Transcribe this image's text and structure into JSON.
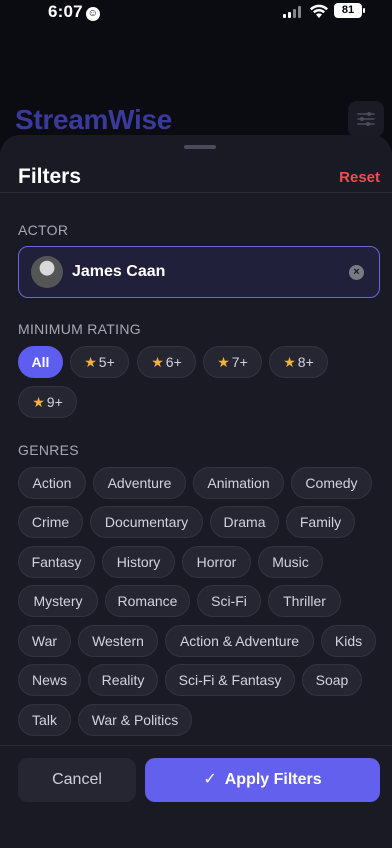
{
  "status": {
    "time": "6:07",
    "battery": "81"
  },
  "background": {
    "app_title": "StreamWise"
  },
  "sheet": {
    "title": "Filters",
    "reset_label": "Reset",
    "actor": {
      "label": "ACTOR",
      "name": "James Caan"
    },
    "rating": {
      "label": "MINIMUM RATING",
      "options": [
        "All",
        "5+",
        "6+",
        "7+",
        "8+",
        "9+"
      ],
      "selected": "All"
    },
    "genres": {
      "label": "GENRES",
      "items": [
        "Action",
        "Adventure",
        "Animation",
        "Comedy",
        "Crime",
        "Documentary",
        "Drama",
        "Family",
        "Fantasy",
        "History",
        "Horror",
        "Music",
        "Mystery",
        "Romance",
        "Sci-Fi",
        "Thriller",
        "War",
        "Western",
        "Action & Adventure",
        "Kids",
        "News",
        "Reality",
        "Sci-Fi & Fantasy",
        "Soap",
        "Talk",
        "War & Politics"
      ]
    }
  },
  "footer": {
    "cancel_label": "Cancel",
    "apply_label": "Apply Filters"
  },
  "colors": {
    "accent": "#6360ee",
    "reset": "#ef4f4f",
    "star": "#f2b33d",
    "sheet_bg": "#1a1a24"
  },
  "icons": {
    "clear": "close-circle-icon",
    "apply": "check-icon",
    "filter": "sliders-icon"
  }
}
